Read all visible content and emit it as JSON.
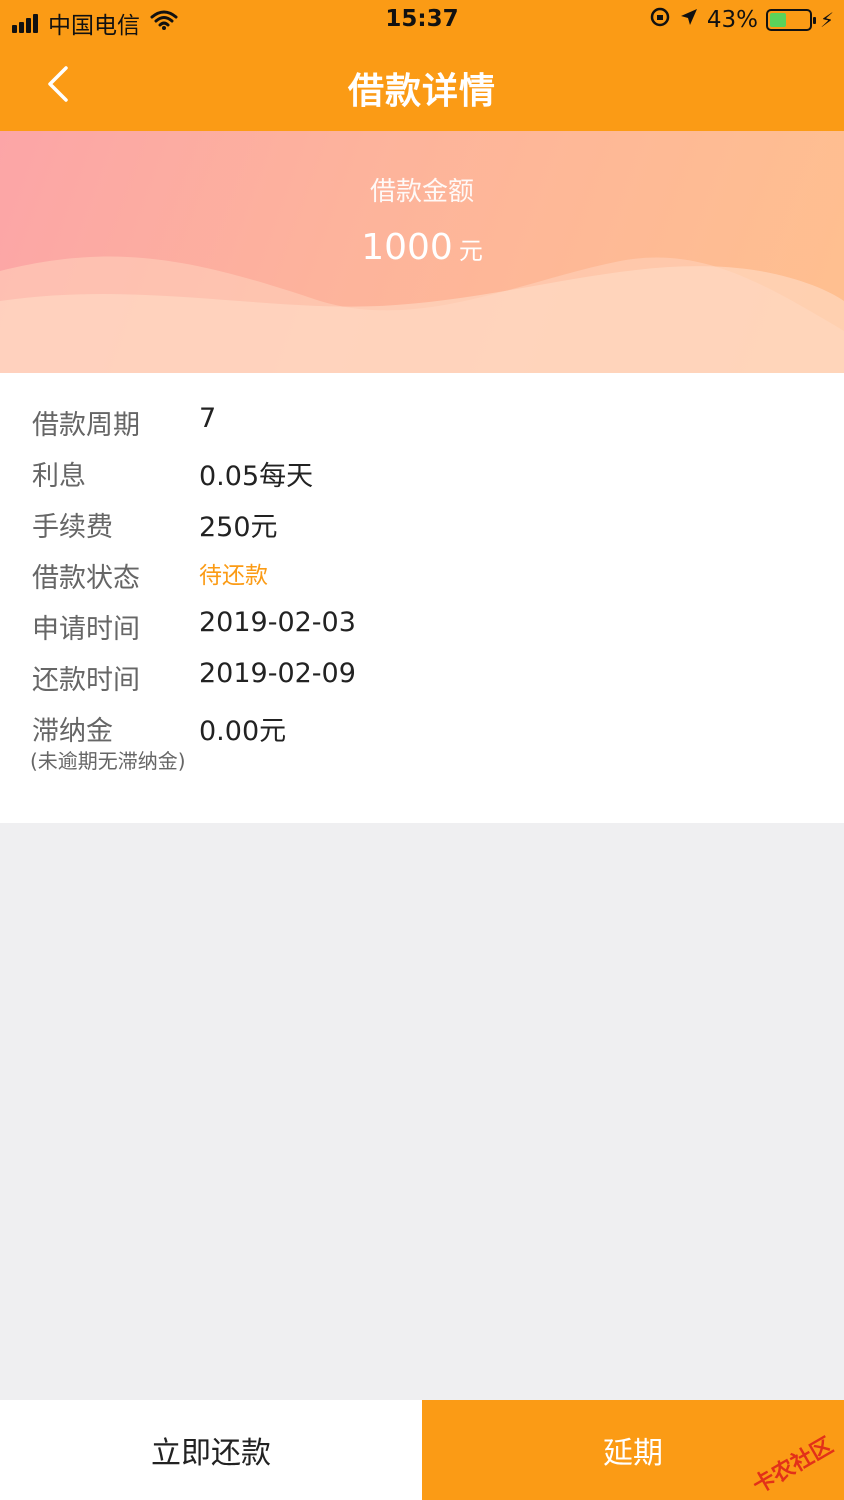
{
  "status_bar": {
    "carrier": "中国电信",
    "time": "15:37",
    "battery": "43%",
    "battery_level": 0.43,
    "icons": [
      "signal-icon",
      "wifi-icon",
      "orientation-lock-icon",
      "location-icon",
      "battery-icon",
      "charging-icon"
    ]
  },
  "nav": {
    "title": "借款详情",
    "back_icon": "chevron-left-icon"
  },
  "hero": {
    "label": "借款金额",
    "amount": "1000",
    "unit": "元"
  },
  "details": {
    "rows": [
      {
        "key": "借款周期",
        "value": "7"
      },
      {
        "key": "利息",
        "value": "0.05每天"
      },
      {
        "key": "手续费",
        "value": "250元"
      },
      {
        "key": "借款状态",
        "value": "待还款"
      },
      {
        "key": "申请时间",
        "value": "2019-02-03"
      },
      {
        "key": "还款时间",
        "value": "2019-02-09"
      },
      {
        "key": "滞纳金",
        "value": "0.00元"
      }
    ],
    "note": "(未逾期无滞纳金)"
  },
  "buttons": {
    "repay": "立即还款",
    "extend": "延期"
  },
  "watermark": "卡农社区",
  "colors": {
    "accent": "#fb9b15",
    "status_text": "#fb9b15",
    "background": "#efeff1"
  }
}
